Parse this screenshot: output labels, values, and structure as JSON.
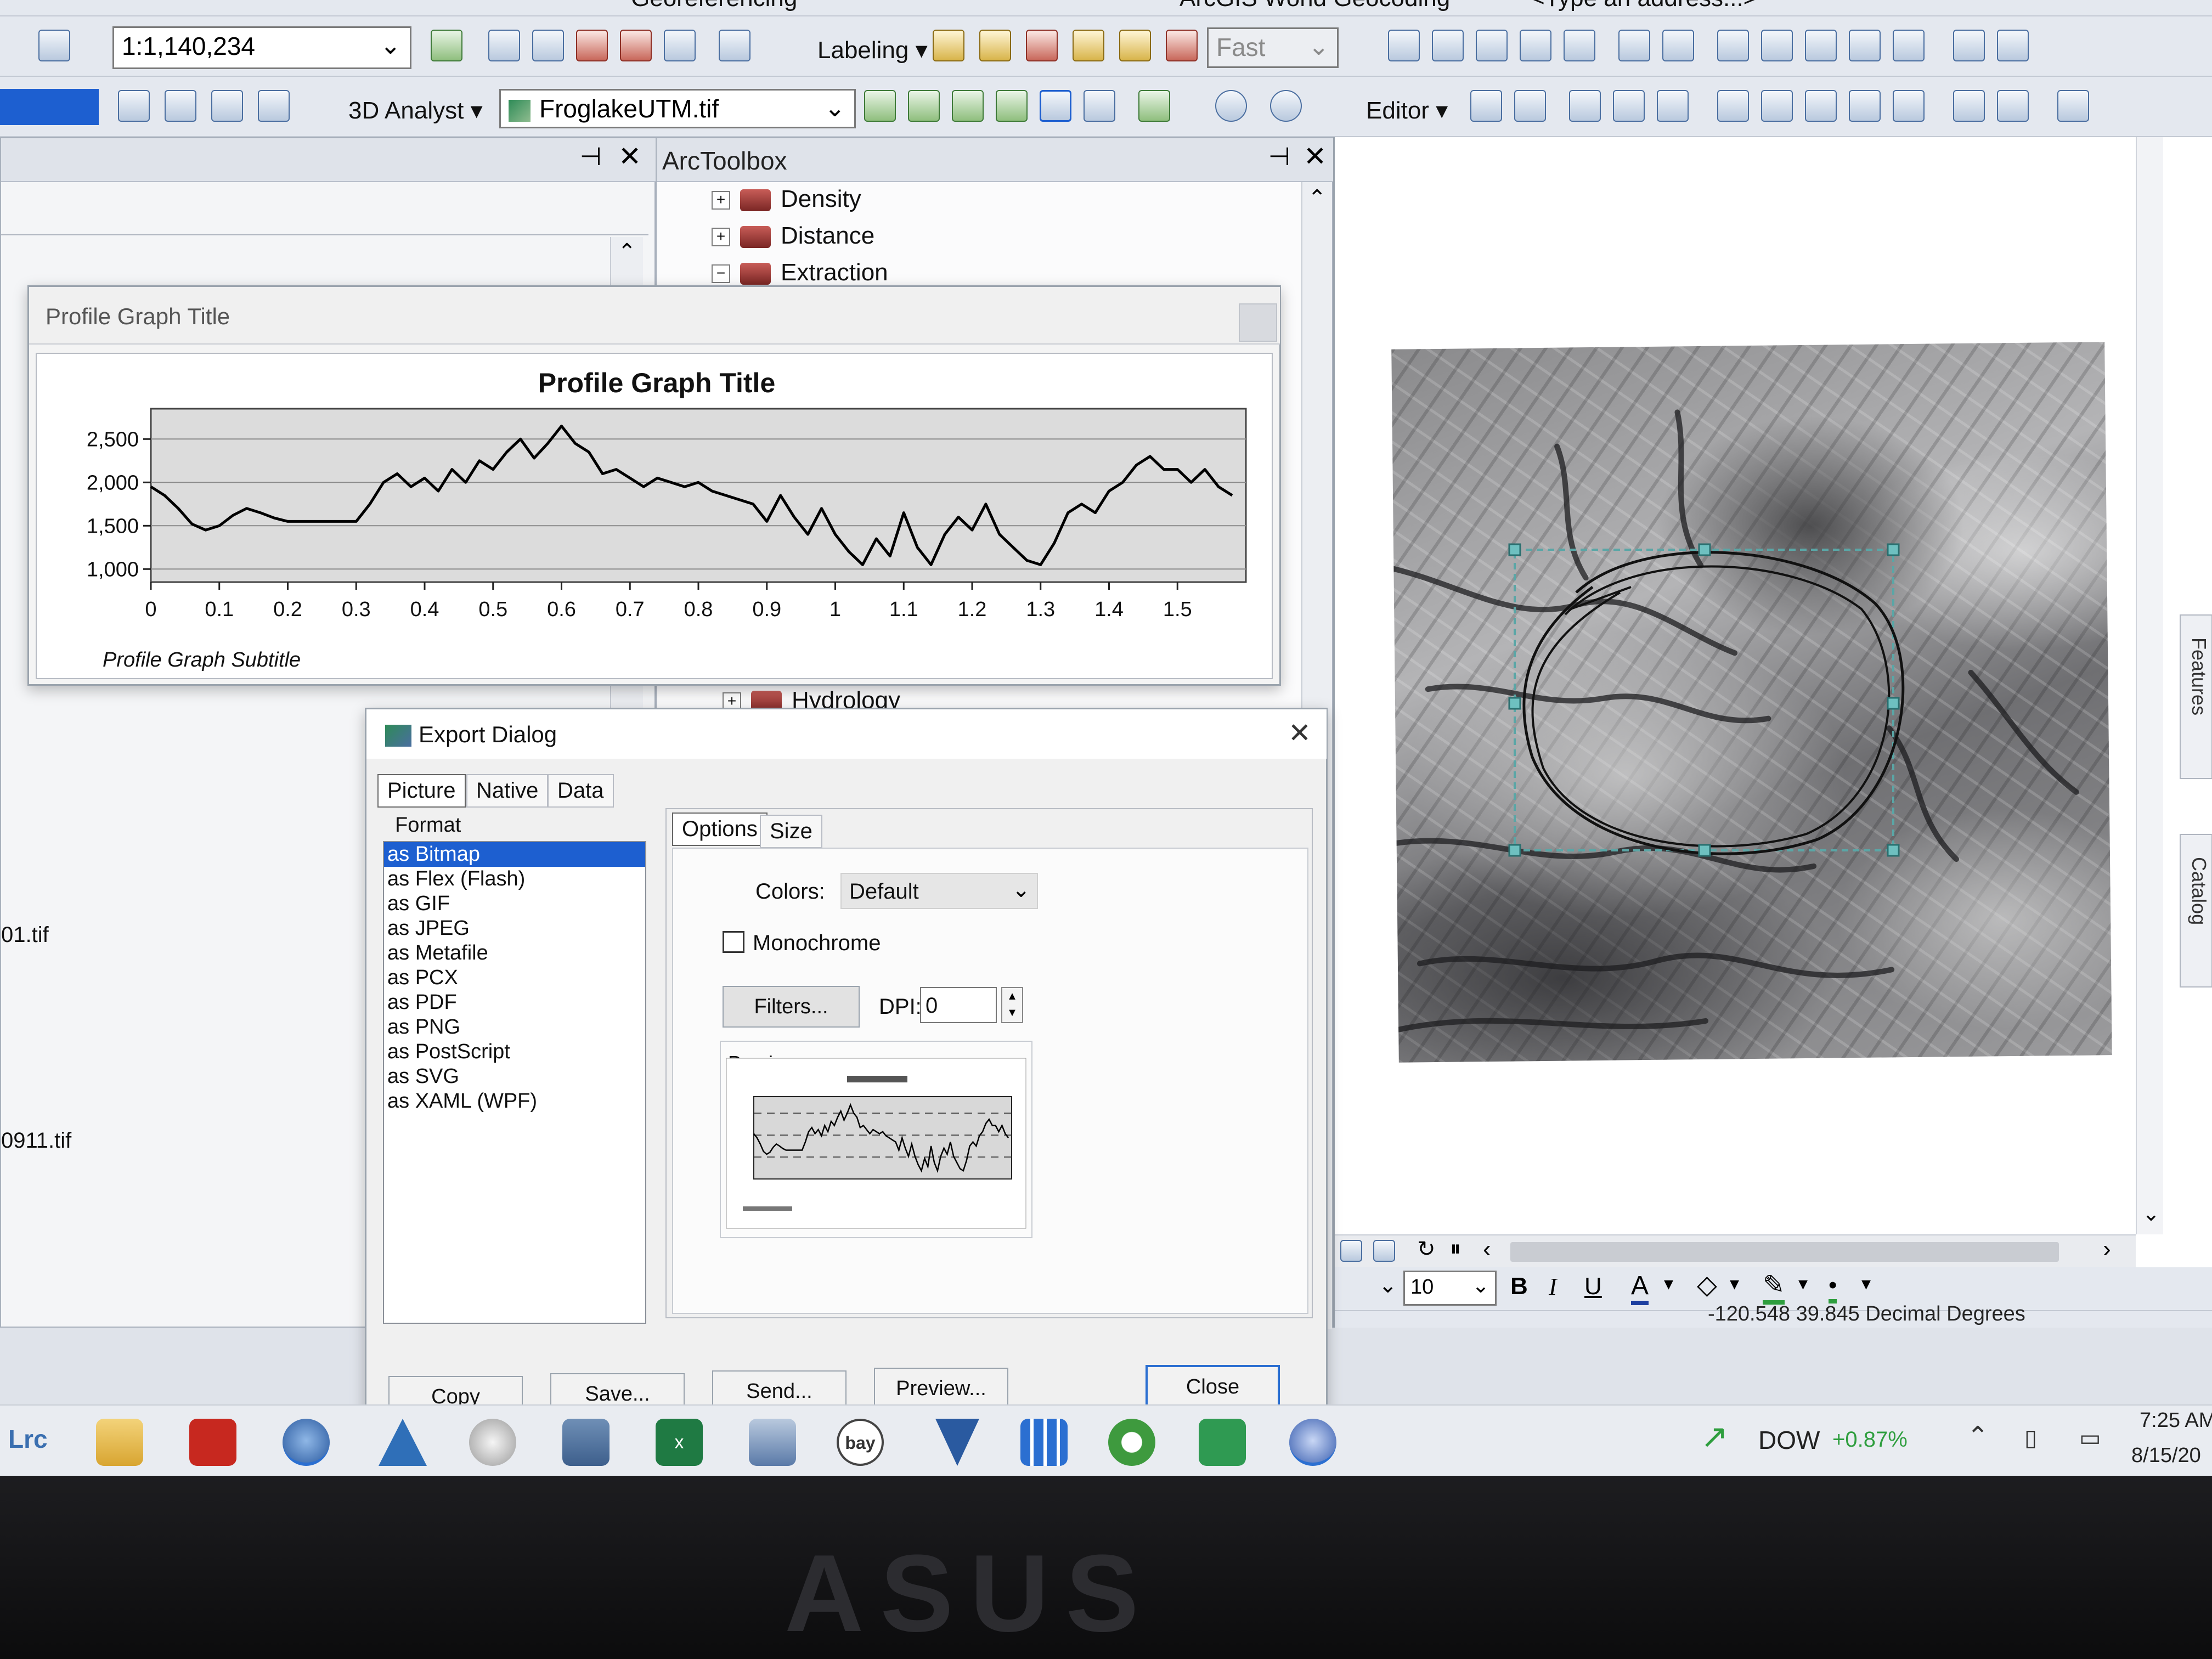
{
  "toolbar1": {
    "georef_label": "Georeferencing",
    "geocoding_label": "ArcGIS World Geocoding",
    "address_placeholder": "<Type an address...>"
  },
  "toolbar2": {
    "scale_value": "1:1,140,234",
    "labeling_label": "Labeling",
    "quality_value": "Fast"
  },
  "toolbar3": {
    "analyst_label": "3D Analyst",
    "layer_value": "FroglakeUTM.tif",
    "editor_label": "Editor"
  },
  "toc_panel": {
    "file_1": "01.tif",
    "file_2": "0911.tif"
  },
  "arctoolbox": {
    "title": "ArcToolbox",
    "items": [
      {
        "label": "Density",
        "expander": "+"
      },
      {
        "label": "Distance",
        "expander": "+"
      },
      {
        "label": "Extraction",
        "expander": "−"
      }
    ],
    "partial_item": "Hydrology"
  },
  "profile_graph": {
    "window_title": "Profile Graph Title",
    "title": "Profile Graph Title",
    "subtitle": "Profile Graph Subtitle",
    "y_ticks": [
      "1,000",
      "1,500",
      "2,000",
      "2,500"
    ],
    "x_ticks": [
      "0",
      "0.1",
      "0.2",
      "0.3",
      "0.4",
      "0.5",
      "0.6",
      "0.7",
      "0.8",
      "0.9",
      "1",
      "1.1",
      "1.2",
      "1.3",
      "1.4",
      "1.5"
    ]
  },
  "chart_data": {
    "type": "line",
    "title": "Profile Graph Title",
    "subtitle": "Profile Graph Subtitle",
    "xlabel": "",
    "ylabel": "",
    "xlim": [
      0,
      1.6
    ],
    "ylim": [
      850,
      2850
    ],
    "grid": true,
    "series": [
      {
        "x": [
          0,
          0.02,
          0.04,
          0.06,
          0.08,
          0.1,
          0.12,
          0.14,
          0.16,
          0.18,
          0.2,
          0.22,
          0.24,
          0.26,
          0.28,
          0.3,
          0.32,
          0.34,
          0.36,
          0.38,
          0.4,
          0.42,
          0.44,
          0.46,
          0.48,
          0.5,
          0.52,
          0.54,
          0.56,
          0.58,
          0.6,
          0.62,
          0.64,
          0.66,
          0.68,
          0.7,
          0.72,
          0.74,
          0.76,
          0.78,
          0.8,
          0.82,
          0.84,
          0.86,
          0.88,
          0.9,
          0.92,
          0.94,
          0.96,
          0.98,
          1.0,
          1.02,
          1.04,
          1.06,
          1.08,
          1.1,
          1.12,
          1.14,
          1.16,
          1.18,
          1.2,
          1.22,
          1.24,
          1.26,
          1.28,
          1.3,
          1.32,
          1.34,
          1.36,
          1.38,
          1.4,
          1.42,
          1.44,
          1.46,
          1.48,
          1.5,
          1.52,
          1.54,
          1.56,
          1.58
        ],
        "y": [
          1950,
          1850,
          1700,
          1520,
          1450,
          1500,
          1620,
          1700,
          1650,
          1590,
          1550,
          1550,
          1550,
          1550,
          1550,
          1550,
          1750,
          2000,
          2100,
          1950,
          2050,
          1900,
          2150,
          2000,
          2250,
          2150,
          2350,
          2500,
          2280,
          2450,
          2650,
          2450,
          2350,
          2100,
          2150,
          2050,
          1950,
          2050,
          2000,
          1950,
          2000,
          1900,
          1850,
          1800,
          1750,
          1550,
          1850,
          1600,
          1400,
          1700,
          1400,
          1200,
          1050,
          1350,
          1150,
          1650,
          1250,
          1050,
          1400,
          1600,
          1450,
          1750,
          1400,
          1250,
          1100,
          1050,
          1300,
          1650,
          1750,
          1650,
          1900,
          2000,
          2200,
          2300,
          2150,
          2150,
          2000,
          2150,
          1950,
          1850
        ]
      }
    ]
  },
  "export_dialog": {
    "title": "Export Dialog",
    "tabs": [
      "Picture",
      "Native",
      "Data"
    ],
    "format_label": "Format",
    "formats": [
      "as Bitmap",
      "as Flex (Flash)",
      "as GIF",
      "as JPEG",
      "as Metafile",
      "as PCX",
      "as PDF",
      "as PNG",
      "as PostScript",
      "as SVG",
      "as XAML (WPF)"
    ],
    "selected_format": "as Bitmap",
    "subtabs": [
      "Options",
      "Size"
    ],
    "colors_label": "Colors:",
    "colors_value": "Default",
    "monochrome_label": "Monochrome",
    "filters_button": "Filters...",
    "dpi_label": "DPI:",
    "dpi_value": "0",
    "preview_label": "Preview:",
    "buttons": {
      "copy": "Copy",
      "save": "Save...",
      "send": "Send...",
      "preview": "Preview...",
      "close": "Close"
    }
  },
  "map_view": {
    "font_size_value": "10",
    "bold_label": "B",
    "italic_label": "I",
    "underline_label": "U",
    "color_a_label": "A",
    "coordinates": "-120.548  39.845 Decimal Degrees",
    "side_tab_catalog": "Catalog",
    "side_tab_features": "Features"
  },
  "taskbar": {
    "lrc_label": "Lrc",
    "excel_badge": "x",
    "ebay_label": "bay",
    "ticker_label": "DOW",
    "ticker_change": "+0.87%",
    "time": "7:25 AM",
    "date": "8/15/20",
    "colors": {
      "ticker_positive": "#2e9e3e"
    }
  },
  "laptop": {
    "brand": "ASUS"
  }
}
